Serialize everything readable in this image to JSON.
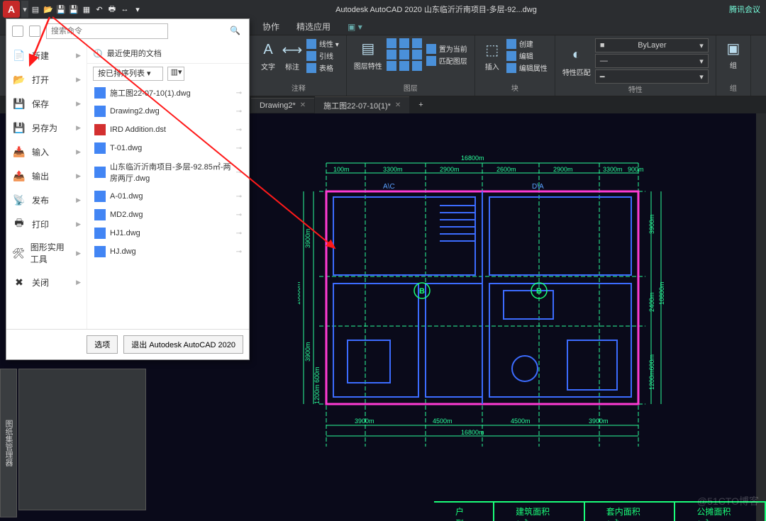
{
  "title": "Autodesk AutoCAD 2020    山东临沂沂南项目-多层-92...dwg",
  "titlebar_right": "腾讯会议",
  "tabs": {
    "t1": "协作",
    "t2": "精选应用",
    "add": "▣ ▾"
  },
  "ribbon": {
    "annot": {
      "text": "文字",
      "label_btn": "标注",
      "line": "线性 ▾",
      "leader": "引线",
      "table": "表格",
      "panel": "注释"
    },
    "layerp": {
      "btn": "图层特性",
      "panel": "图层"
    },
    "layer_tools": {
      "a": "置为当前",
      "b": "匹配图层"
    },
    "blockp": {
      "insert": "插入",
      "panel": "块",
      "create": "创建",
      "edit": "编辑",
      "attr": "编辑属性"
    },
    "propsp": {
      "match": "特性匹配",
      "bylayer": "ByLayer",
      "panel": "特性"
    },
    "group": {
      "label": "组",
      "panel": "组"
    }
  },
  "doctabs": {
    "d1": "Drawing2*",
    "d2": "施工图22-07-10(1)*",
    "add": "+"
  },
  "appmenu": {
    "search_placeholder": "搜索命令",
    "recent_label": "最近使用的文档",
    "sort_label": "按已排序列表 ▾",
    "left": [
      {
        "k": "new",
        "label": "新建"
      },
      {
        "k": "open",
        "label": "打开"
      },
      {
        "k": "save",
        "label": "保存"
      },
      {
        "k": "saveas",
        "label": "另存为"
      },
      {
        "k": "import",
        "label": "输入"
      },
      {
        "k": "export",
        "label": "输出"
      },
      {
        "k": "publish",
        "label": "发布"
      },
      {
        "k": "print",
        "label": "打印"
      },
      {
        "k": "util",
        "label": "图形实用工具"
      },
      {
        "k": "close",
        "label": "关闭"
      }
    ],
    "docs": [
      {
        "name": "施工图22-07-10(1).dwg",
        "t": "dwg"
      },
      {
        "name": "Drawing2.dwg",
        "t": "dwg"
      },
      {
        "name": "IRD Addition.dst",
        "t": "dst"
      },
      {
        "name": "T-01.dwg",
        "t": "dwg"
      },
      {
        "name": "山东临沂沂南项目-多层-92.85㎡-两房两厅.dwg",
        "t": "dwg"
      },
      {
        "name": "A-01.dwg",
        "t": "dwg"
      },
      {
        "name": "MD2.dwg",
        "t": "dwg"
      },
      {
        "name": "HJ1.dwg",
        "t": "dwg"
      },
      {
        "name": "HJ.dwg",
        "t": "dwg"
      }
    ],
    "footer": {
      "options": "选项",
      "exit": "退出 Autodesk AutoCAD 2020"
    }
  },
  "side_stub": "图纸集管理器",
  "watermark": "@51CTO博客",
  "dims": {
    "top_total": "16800m",
    "top": [
      "100m",
      "3300m",
      "2900m",
      "2600m",
      "2900m",
      "3300m",
      "900m"
    ],
    "left_total": "10800m",
    "left": [
      "3900m",
      "3900m"
    ],
    "right_total": "10800m",
    "right": [
      "3900m",
      "2400m",
      "1200m600m"
    ],
    "bottom": [
      "3900m",
      "4500m",
      "4500m",
      "3900m"
    ],
    "bottom_total": "16800m",
    "rooms": {
      "ac": "A\\C",
      "da": "D\\A",
      "b": "B"
    },
    "left_small": "1200m 600m"
  },
  "bottom_tbl": {
    "c1": "户型",
    "c2": "建筑面积(㎡)",
    "c3": "套内面积(㎡)",
    "c4": "公摊面积(㎡)"
  }
}
